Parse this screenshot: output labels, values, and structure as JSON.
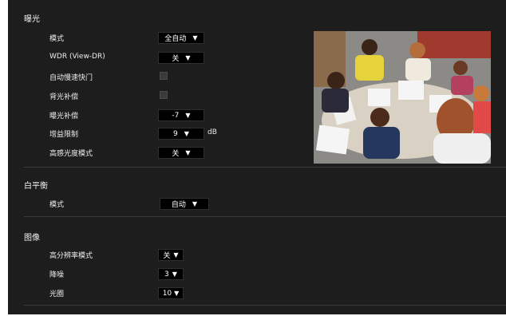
{
  "exposure": {
    "title": "曝光",
    "mode_label": "模式",
    "mode_value": "全自动",
    "wdr_label": "WDR (View-DR)",
    "wdr_value": "关",
    "auto_slow_shutter_label": "自动慢速快门",
    "backlight_comp_label": "背光补偿",
    "exposure_comp_label": "曝光补偿",
    "exposure_comp_value": "-7",
    "gain_limit_label": "增益限制",
    "gain_limit_value": "9",
    "gain_unit": "dB",
    "high_sensitivity_label": "高感光度模式",
    "high_sensitivity_value": "关"
  },
  "white_balance": {
    "title": "白平衡",
    "mode_label": "模式",
    "mode_value": "自动"
  },
  "image": {
    "title": "图像",
    "high_res_label": "高分辨率模式",
    "high_res_value": "关",
    "noise_reduction_label": "降噪",
    "noise_reduction_value": "3",
    "iris_label": "光圈",
    "iris_value": "10"
  },
  "icons": {
    "dropdown": "chevron-down-icon"
  }
}
